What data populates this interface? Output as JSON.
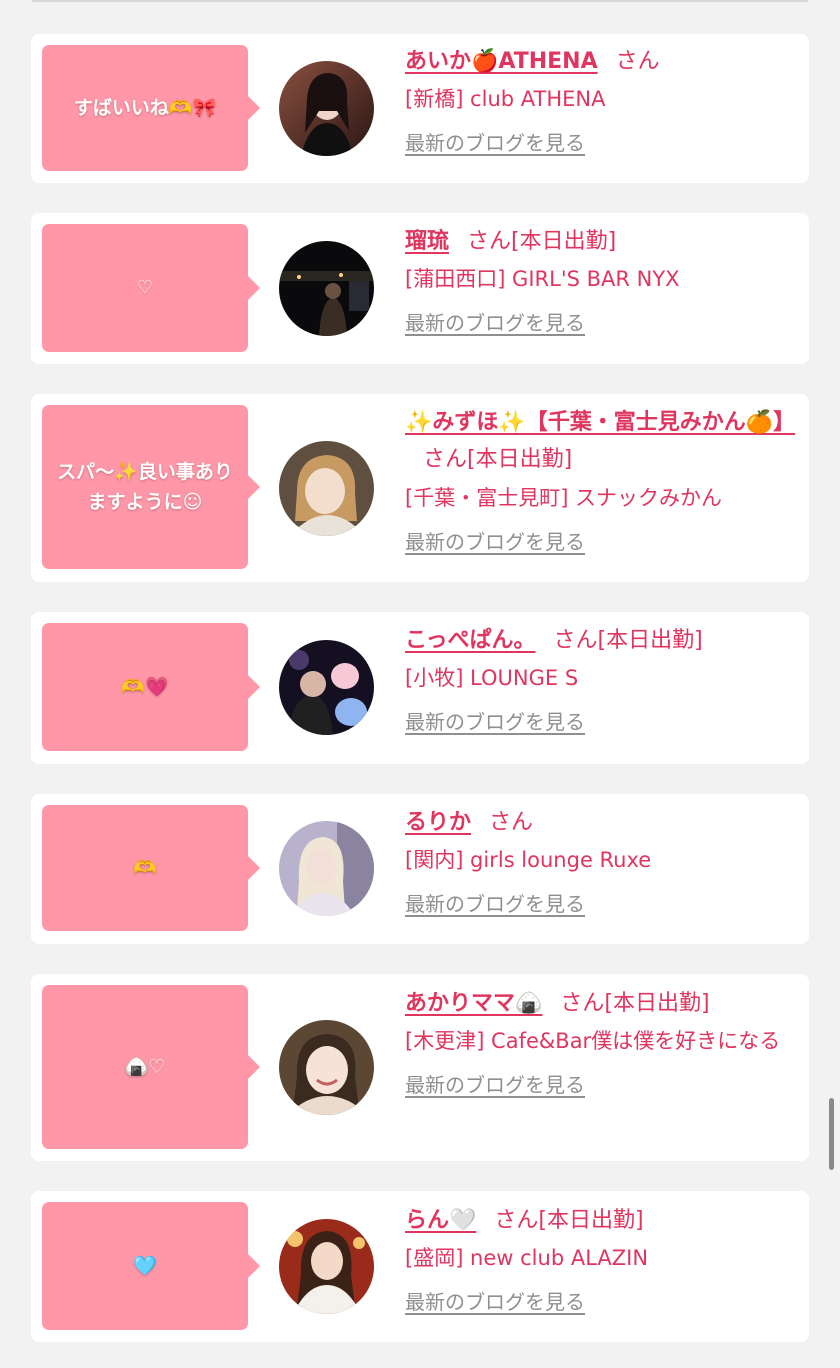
{
  "cards": [
    {
      "comment": "すばいいね🫶🎀",
      "name": "あいか🍎ATHENA",
      "honorific": "さん",
      "status": "",
      "shop": "[新橋] club ATHENA",
      "blog_link": "最新のブログを見る",
      "avatar_icon": "photo-avatar",
      "avatar_colors": [
        "#3a2420",
        "#8a5040"
      ]
    },
    {
      "comment": "♡",
      "name": "瑠琉",
      "honorific": "さん",
      "status": "[本日出勤]",
      "shop": "[蒲田西口] GIRL'S BAR NYX",
      "blog_link": "最新のブログを見る",
      "avatar_icon": "photo-avatar",
      "avatar_colors": [
        "#0a0a0c",
        "#2a2620"
      ]
    },
    {
      "comment": "スパ〜✨良い事ありますように☺",
      "name": "✨みずほ✨【千葉・富士見みかん🍊】",
      "honorific": "さん",
      "status": "[本日出勤]",
      "shop": "[千葉・富士見町] スナックみかん",
      "blog_link": "最新のブログを見る",
      "avatar_icon": "photo-avatar",
      "avatar_colors": [
        "#6a5a48",
        "#d9b48a"
      ]
    },
    {
      "comment": "🫶💗",
      "name": "こっぺぱん。",
      "honorific": "さん",
      "status": "[本日出勤]",
      "shop": "[小牧] LOUNGE S",
      "blog_link": "最新のブログを見る",
      "avatar_icon": "photo-avatar",
      "avatar_colors": [
        "#141022",
        "#4a3a6a"
      ]
    },
    {
      "comment": "🫶",
      "name": "るりか",
      "honorific": "さん",
      "status": "",
      "shop": "[関内] girls lounge Ruxe",
      "blog_link": "最新のブログを見る",
      "avatar_icon": "photo-avatar",
      "avatar_colors": [
        "#b8b2cc",
        "#e9e4ee"
      ]
    },
    {
      "comment": "🍙♡",
      "name": "あかりママ🍙",
      "honorific": "さん",
      "status": "[本日出勤]",
      "shop": "[木更津] Cafe&Bar僕は僕を好きになる",
      "blog_link": "最新のブログを見る",
      "avatar_icon": "photo-avatar",
      "avatar_colors": [
        "#7a5a3a",
        "#eadbcc"
      ]
    },
    {
      "comment": "🩵",
      "name": "らん🤍",
      "honorific": "さん",
      "status": "[本日出勤]",
      "shop": "[盛岡] new club ALAZIN",
      "blog_link": "最新のブログを見る",
      "avatar_icon": "photo-avatar",
      "avatar_colors": [
        "#9a2a1a",
        "#e8b878"
      ]
    }
  ]
}
